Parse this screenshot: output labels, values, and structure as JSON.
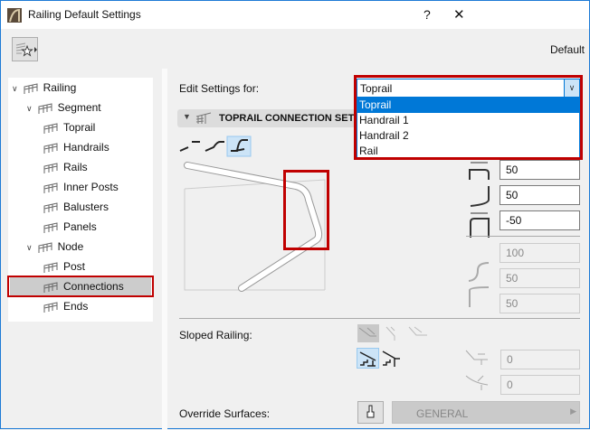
{
  "window": {
    "title": "Railing Default Settings",
    "help": "?",
    "close": "✕"
  },
  "header": {
    "preset_name": "Default"
  },
  "tree": {
    "items": [
      {
        "label": "Railing",
        "level": 0,
        "expanded": true
      },
      {
        "label": "Segment",
        "level": 1,
        "expanded": true
      },
      {
        "label": "Toprail",
        "level": 2
      },
      {
        "label": "Handrails",
        "level": 2
      },
      {
        "label": "Rails",
        "level": 2
      },
      {
        "label": "Inner Posts",
        "level": 2
      },
      {
        "label": "Balusters",
        "level": 2
      },
      {
        "label": "Panels",
        "level": 2
      },
      {
        "label": "Node",
        "level": 1,
        "expanded": true
      },
      {
        "label": "Post",
        "level": 2
      },
      {
        "label": "Connections",
        "level": 2,
        "selected": true
      },
      {
        "label": "Ends",
        "level": 2
      }
    ]
  },
  "edit_settings": {
    "label": "Edit Settings for:",
    "value": "Toprail",
    "options": [
      "Toprail",
      "Handrail 1",
      "Handrail 2",
      "Rail"
    ]
  },
  "section": {
    "title": "TOPRAIL CONNECTION SETTINGS"
  },
  "fields": {
    "f1": "50",
    "f2": "50",
    "f3": "-50",
    "f4": "100",
    "f5": "50",
    "f6": "50",
    "s1": "0",
    "s2": "0"
  },
  "sloped": {
    "label": "Sloped Railing:"
  },
  "override": {
    "label": "Override Surfaces:",
    "surface": "GENERAL"
  },
  "colors": {
    "accent": "#0078d7",
    "highlight": "#c00000",
    "selected_bg": "#cce4f7"
  }
}
